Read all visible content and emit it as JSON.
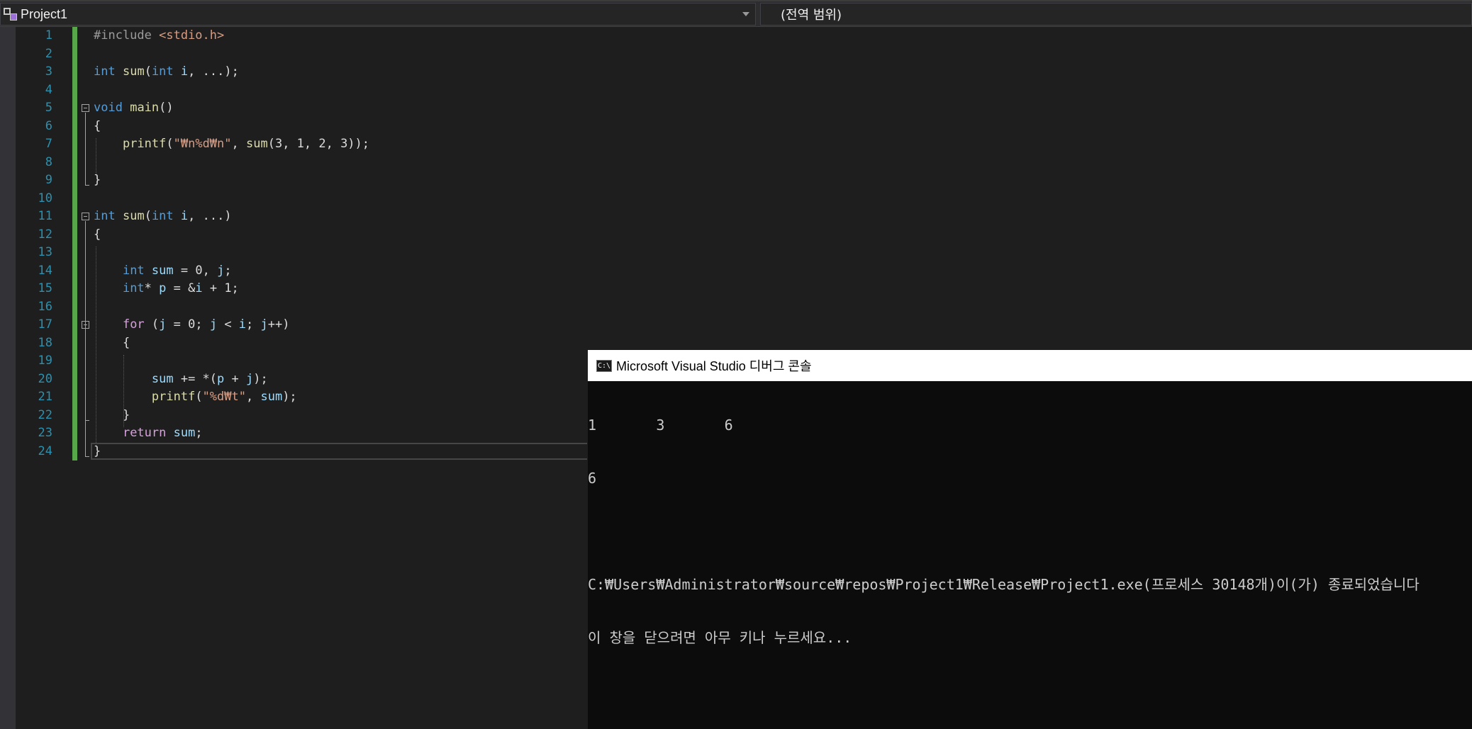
{
  "navbar": {
    "project_label": "Project1",
    "scope_label": "(전역 범위)"
  },
  "editor": {
    "lines": [
      {
        "n": "1",
        "tokens": [
          {
            "t": "#include ",
            "c": "pp"
          },
          {
            "t": "<stdio.h>",
            "c": "str"
          }
        ]
      },
      {
        "n": "2",
        "tokens": []
      },
      {
        "n": "3",
        "tokens": [
          {
            "t": "int",
            "c": "kw"
          },
          {
            "t": " ",
            "c": ""
          },
          {
            "t": "sum",
            "c": "fn"
          },
          {
            "t": "(",
            "c": ""
          },
          {
            "t": "int",
            "c": "kw"
          },
          {
            "t": " ",
            "c": ""
          },
          {
            "t": "i",
            "c": "var"
          },
          {
            "t": ", ...);",
            "c": ""
          }
        ]
      },
      {
        "n": "4",
        "tokens": []
      },
      {
        "n": "5",
        "tokens": [
          {
            "t": "void",
            "c": "kw"
          },
          {
            "t": " ",
            "c": ""
          },
          {
            "t": "main",
            "c": "fn"
          },
          {
            "t": "()",
            "c": ""
          }
        ]
      },
      {
        "n": "6",
        "tokens": [
          {
            "t": "{",
            "c": ""
          }
        ]
      },
      {
        "n": "7",
        "tokens": [
          {
            "t": "    ",
            "c": ""
          },
          {
            "t": "printf",
            "c": "fn"
          },
          {
            "t": "(",
            "c": ""
          },
          {
            "t": "\"₩n%d₩n\"",
            "c": "str"
          },
          {
            "t": ", ",
            "c": ""
          },
          {
            "t": "sum",
            "c": "fn"
          },
          {
            "t": "(3, 1, 2, 3));",
            "c": ""
          }
        ]
      },
      {
        "n": "8",
        "tokens": []
      },
      {
        "n": "9",
        "tokens": [
          {
            "t": "}",
            "c": ""
          }
        ]
      },
      {
        "n": "10",
        "tokens": []
      },
      {
        "n": "11",
        "tokens": [
          {
            "t": "int",
            "c": "kw"
          },
          {
            "t": " ",
            "c": ""
          },
          {
            "t": "sum",
            "c": "fn"
          },
          {
            "t": "(",
            "c": ""
          },
          {
            "t": "int",
            "c": "kw"
          },
          {
            "t": " ",
            "c": ""
          },
          {
            "t": "i",
            "c": "var"
          },
          {
            "t": ", ...)",
            "c": ""
          }
        ]
      },
      {
        "n": "12",
        "tokens": [
          {
            "t": "{",
            "c": ""
          }
        ]
      },
      {
        "n": "13",
        "tokens": []
      },
      {
        "n": "14",
        "tokens": [
          {
            "t": "    ",
            "c": ""
          },
          {
            "t": "int",
            "c": "kw"
          },
          {
            "t": " ",
            "c": ""
          },
          {
            "t": "sum",
            "c": "var"
          },
          {
            "t": " = 0, ",
            "c": ""
          },
          {
            "t": "j",
            "c": "var"
          },
          {
            "t": ";",
            "c": ""
          }
        ]
      },
      {
        "n": "15",
        "tokens": [
          {
            "t": "    ",
            "c": ""
          },
          {
            "t": "int",
            "c": "kw"
          },
          {
            "t": "* ",
            "c": ""
          },
          {
            "t": "p",
            "c": "var"
          },
          {
            "t": " = &",
            "c": ""
          },
          {
            "t": "i",
            "c": "var"
          },
          {
            "t": " + 1;",
            "c": ""
          }
        ]
      },
      {
        "n": "16",
        "tokens": []
      },
      {
        "n": "17",
        "tokens": [
          {
            "t": "    ",
            "c": ""
          },
          {
            "t": "for",
            "c": "ctl"
          },
          {
            "t": " (",
            "c": ""
          },
          {
            "t": "j",
            "c": "var"
          },
          {
            "t": " = 0; ",
            "c": ""
          },
          {
            "t": "j",
            "c": "var"
          },
          {
            "t": " < ",
            "c": ""
          },
          {
            "t": "i",
            "c": "var"
          },
          {
            "t": "; ",
            "c": ""
          },
          {
            "t": "j",
            "c": "var"
          },
          {
            "t": "++)",
            "c": ""
          }
        ]
      },
      {
        "n": "18",
        "tokens": [
          {
            "t": "    {",
            "c": ""
          }
        ]
      },
      {
        "n": "19",
        "tokens": []
      },
      {
        "n": "20",
        "tokens": [
          {
            "t": "        ",
            "c": ""
          },
          {
            "t": "sum",
            "c": "var"
          },
          {
            "t": " += *(",
            "c": ""
          },
          {
            "t": "p",
            "c": "var"
          },
          {
            "t": " + ",
            "c": ""
          },
          {
            "t": "j",
            "c": "var"
          },
          {
            "t": ");",
            "c": ""
          }
        ]
      },
      {
        "n": "21",
        "tokens": [
          {
            "t": "        ",
            "c": ""
          },
          {
            "t": "printf",
            "c": "fn"
          },
          {
            "t": "(",
            "c": ""
          },
          {
            "t": "\"%d₩t\"",
            "c": "str"
          },
          {
            "t": ", ",
            "c": ""
          },
          {
            "t": "sum",
            "c": "var"
          },
          {
            "t": ");",
            "c": ""
          }
        ]
      },
      {
        "n": "22",
        "tokens": [
          {
            "t": "    }",
            "c": ""
          }
        ]
      },
      {
        "n": "23",
        "tokens": [
          {
            "t": "    ",
            "c": ""
          },
          {
            "t": "return",
            "c": "ctl"
          },
          {
            "t": " ",
            "c": ""
          },
          {
            "t": "sum",
            "c": "var"
          },
          {
            "t": ";",
            "c": ""
          }
        ]
      },
      {
        "n": "24",
        "tokens": [
          {
            "t": "}",
            "c": ""
          }
        ]
      }
    ]
  },
  "console": {
    "title": "Microsoft Visual Studio 디버그 콘솔",
    "icon_text": "C:\\",
    "lines": [
      "1       3       6",
      "6",
      "",
      "C:₩Users₩Administrator₩source₩repos₩Project1₩Release₩Project1.exe(프로세스 30148개)이(가) 종료되었습니다",
      "이 창을 닫으려면 아무 키나 누르세요..."
    ]
  },
  "colors": {
    "editor_bg": "#1e1e1e",
    "keyword": "#569cd6",
    "function": "#dcdcaa",
    "string": "#d69d85",
    "control": "#d8a0df",
    "line_number": "#2b91af",
    "change_bar": "#57a64a",
    "console_bg": "#0c0c0c"
  },
  "icons": [
    "project-icon",
    "dropdown-caret-icon",
    "collapse-icon",
    "console-icon"
  ]
}
